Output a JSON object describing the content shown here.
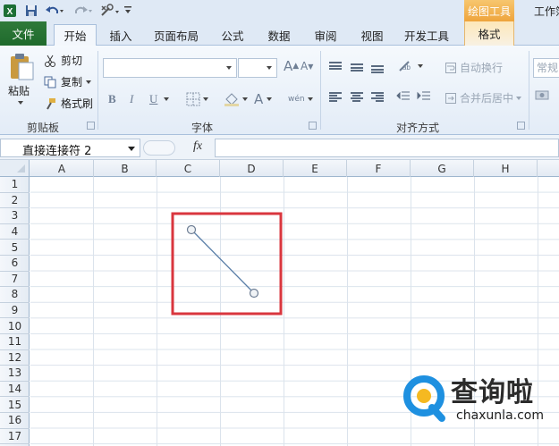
{
  "window": {
    "title_partial": "工作簿"
  },
  "contextual_tab_group": {
    "label": "绘图工具"
  },
  "tabs": [
    {
      "label": "文件"
    },
    {
      "label": "开始"
    },
    {
      "label": "插入"
    },
    {
      "label": "页面布局"
    },
    {
      "label": "公式"
    },
    {
      "label": "数据"
    },
    {
      "label": "审阅"
    },
    {
      "label": "视图"
    },
    {
      "label": "开发工具"
    },
    {
      "label": "格式"
    }
  ],
  "clipboard": {
    "paste_label": "粘贴",
    "cut_label": "剪切",
    "copy_label": "复制",
    "format_painter_label": "格式刷",
    "group_label": "剪贴板"
  },
  "font": {
    "group_label": "字体",
    "bold": "B",
    "italic": "I",
    "underline": "U",
    "grow": "A",
    "shrink": "A",
    "color_a": "A",
    "phonetic": "wén"
  },
  "alignment": {
    "group_label": "对齐方式",
    "wrap_label": "自动换行",
    "merge_label": "合并后居中"
  },
  "number": {
    "format_value": "常规"
  },
  "formula_bar": {
    "name_box_value": "直接连接符 2",
    "fx_label": "fx"
  },
  "sheet": {
    "columns": [
      "A",
      "B",
      "C",
      "D",
      "E",
      "F",
      "G",
      "H"
    ],
    "rows": [
      "1",
      "2",
      "3",
      "4",
      "5",
      "6",
      "7",
      "8",
      "9",
      "10",
      "11",
      "12",
      "13",
      "14",
      "15",
      "16",
      "17"
    ]
  },
  "colors": {
    "file_tab": "#2a7435",
    "selection_box": "#d9363e",
    "connector": "#5b7fa8",
    "watermark_blue": "#1e90e0"
  },
  "watermark": {
    "text": "查询啦",
    "url": "chaxunla.com"
  }
}
